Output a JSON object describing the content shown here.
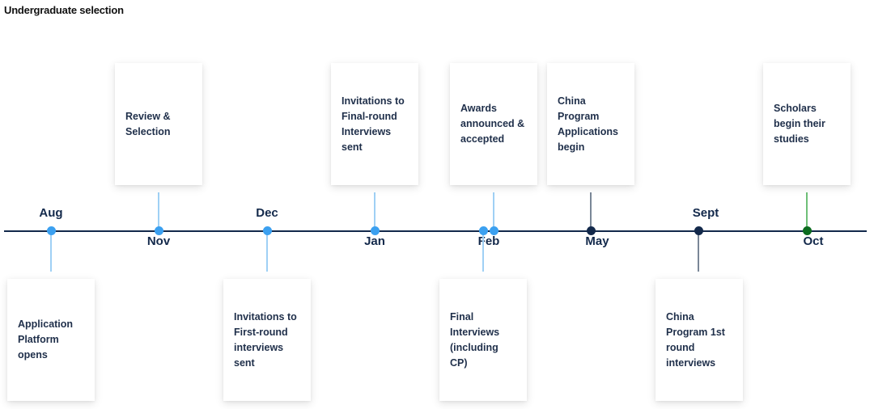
{
  "title": "Undergraduate selection",
  "colors": {
    "axis": "#13294b",
    "blue": "#3ba0f0",
    "blue_stem": "#9fd0f5",
    "navy": "#13294b",
    "navy_stem": "#7a8797",
    "green": "#0b6b1f",
    "green_stem": "#6fbf78"
  },
  "months": [
    {
      "label": "Aug",
      "position": "above"
    },
    {
      "label": "Nov",
      "position": "below"
    },
    {
      "label": "Dec",
      "position": "above"
    },
    {
      "label": "Jan",
      "position": "below"
    },
    {
      "label": "Feb",
      "position": "below"
    },
    {
      "label": "May",
      "position": "below"
    },
    {
      "label": "Sept",
      "position": "above"
    },
    {
      "label": "Oct",
      "position": "below"
    }
  ],
  "events": [
    {
      "month": "Aug",
      "text": "Application Platform opens",
      "side": "below",
      "color": "blue"
    },
    {
      "month": "Nov",
      "text": "Review & Selection",
      "side": "above",
      "color": "blue"
    },
    {
      "month": "Dec",
      "text": "Invitations to First-round interviews sent",
      "side": "below",
      "color": "blue"
    },
    {
      "month": "Jan",
      "text": "Invitations to Final-round Interviews sent",
      "side": "above",
      "color": "blue"
    },
    {
      "month": "Feb",
      "text": "Final Interviews (including CP)",
      "side": "below",
      "color": "blue"
    },
    {
      "month": "Feb",
      "text": "Awards announced & accepted",
      "side": "above",
      "color": "blue"
    },
    {
      "month": "May",
      "text": "China Program Applications begin",
      "side": "above",
      "color": "navy"
    },
    {
      "month": "Sept",
      "text": "China Program 1st round interviews",
      "side": "below",
      "color": "navy"
    },
    {
      "month": "Oct",
      "text": "Scholars begin their studies",
      "side": "above",
      "color": "green"
    }
  ]
}
